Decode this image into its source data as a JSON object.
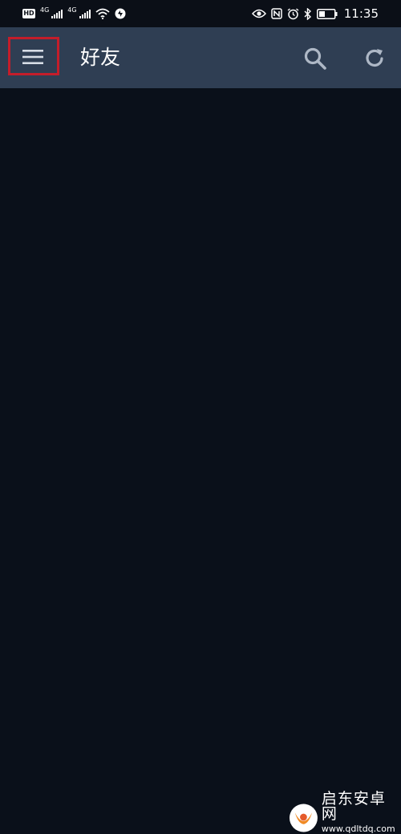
{
  "status_bar": {
    "left_icons": [
      "hd-icon",
      "cellular-signal-icon",
      "cellular-signal-icon",
      "wifi-icon",
      "data-saver-icon"
    ],
    "network_label_1": "4G",
    "network_label_2": "4G",
    "hd_label": "HD",
    "right_icons": [
      "eye-icon",
      "nfc-icon",
      "alarm-icon",
      "bluetooth-icon",
      "battery-icon"
    ],
    "time": "11:35"
  },
  "app_bar": {
    "title": "好友",
    "menu_icon": "hamburger-menu-icon",
    "actions": [
      "search-icon",
      "refresh-icon"
    ]
  },
  "watermark": {
    "title": "启东安卓网",
    "url": "www.qdltdq.com"
  },
  "colors": {
    "app_bar": "#2f3e53",
    "background": "#0a101a",
    "highlight": "#c41d2a"
  }
}
